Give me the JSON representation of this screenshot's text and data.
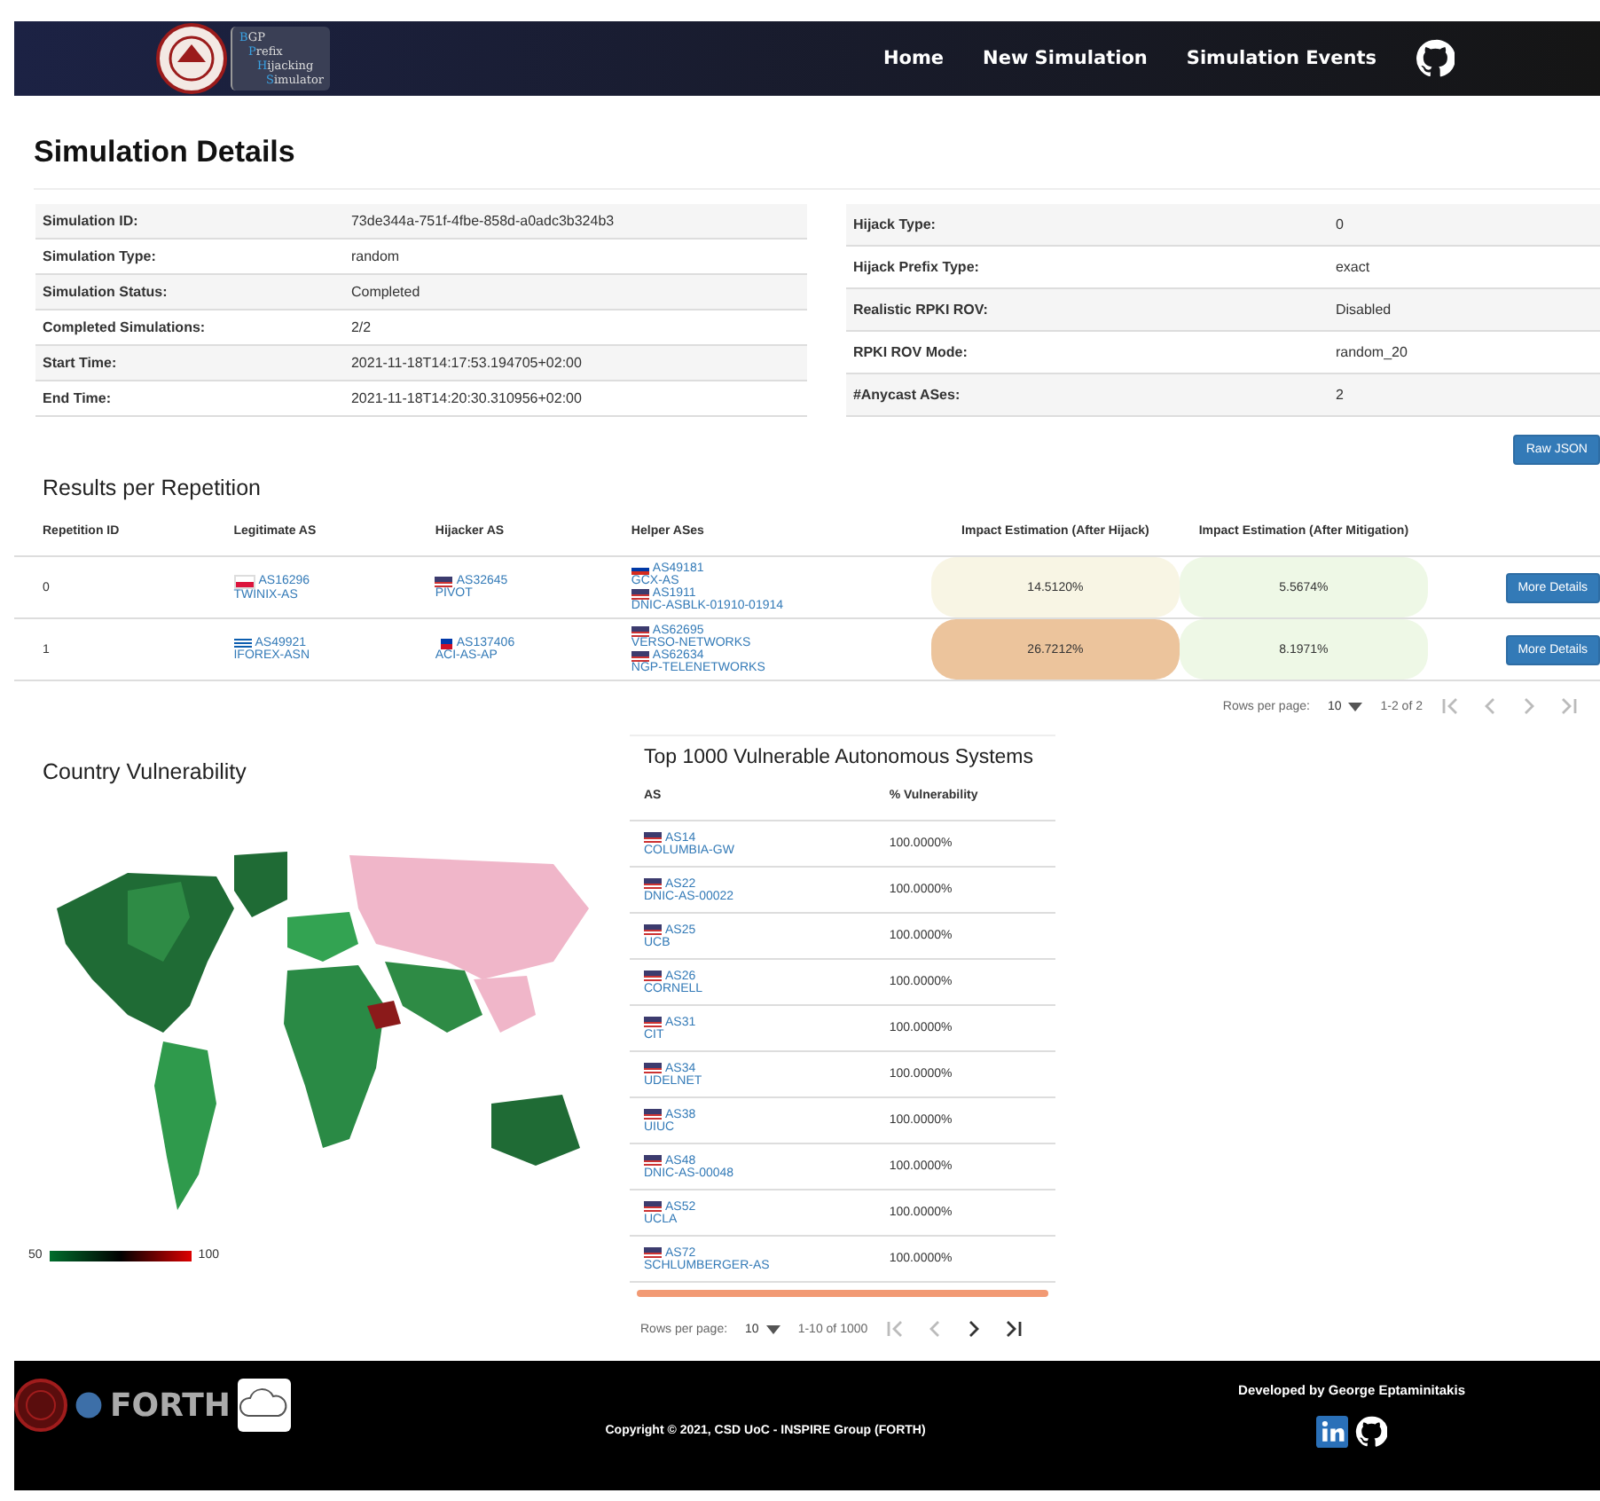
{
  "nav": {
    "logo_lines": [
      "BGP",
      "Prefix",
      "Hijacking",
      "Simulator"
    ],
    "links": [
      "Home",
      "New Simulation",
      "Simulation Events"
    ]
  },
  "title": "Simulation Details",
  "details_left": [
    {
      "label": "Simulation ID:",
      "value": "73de344a-751f-4fbe-858d-a0adc3b324b3"
    },
    {
      "label": "Simulation Type:",
      "value": "random"
    },
    {
      "label": "Simulation Status:",
      "value": "Completed"
    },
    {
      "label": "Completed Simulations:",
      "value": "2/2"
    },
    {
      "label": "Start Time:",
      "value": "2021-11-18T14:17:53.194705+02:00"
    },
    {
      "label": "End Time:",
      "value": "2021-11-18T14:20:30.310956+02:00"
    }
  ],
  "details_right": [
    {
      "label": "Hijack Type:",
      "value": "0"
    },
    {
      "label": "Hijack Prefix Type:",
      "value": "exact"
    },
    {
      "label": "Realistic RPKI ROV:",
      "value": "Disabled"
    },
    {
      "label": "RPKI ROV Mode:",
      "value": "random_20"
    },
    {
      "label": "#Anycast ASes:",
      "value": "2"
    }
  ],
  "raw_button": "Raw JSON",
  "results": {
    "title": "Results per Repetition",
    "columns": [
      "Repetition ID",
      "Legitimate AS",
      "Hijacker AS",
      "Helper ASes",
      "Impact Estimation (After Hijack)",
      "Impact Estimation (After Mitigation)"
    ],
    "rows": [
      {
        "id": "0",
        "legit": {
          "kind": "pl",
          "as": "AS16296",
          "name": "TWINIX-AS"
        },
        "hijacker": {
          "kind": "us",
          "as": "AS32645",
          "name": "PIVOT"
        },
        "helpers": [
          {
            "kind": "ru",
            "as": "AS49181",
            "name": "GCX-AS"
          },
          {
            "kind": "us",
            "as": "AS1911",
            "name": "DNIC-ASBLK-01910-01914"
          }
        ],
        "hijack": {
          "value": "14.5120%",
          "color": "#f8f5e4"
        },
        "mitigation": {
          "value": "5.5674%",
          "color": "#eef8e6"
        },
        "button": "More Details"
      },
      {
        "id": "1",
        "legit": {
          "kind": "gr",
          "as": "AS49921",
          "name": "IFOREX-ASN"
        },
        "hijacker": {
          "kind": "ph",
          "as": "AS137406",
          "name": "ACI-AS-AP"
        },
        "helpers": [
          {
            "kind": "us",
            "as": "AS62695",
            "name": "VERSO-NETWORKS"
          },
          {
            "kind": "us",
            "as": "AS62634",
            "name": "NGP-TELENETWORKS"
          }
        ],
        "hijack": {
          "value": "26.7212%",
          "color": "#ecc49c"
        },
        "mitigation": {
          "value": "8.1971%",
          "color": "#eef8e6"
        },
        "button": "More Details"
      }
    ],
    "pagination": {
      "label": "Rows per page:",
      "per_page": "10",
      "range": "1-2 of 2"
    }
  },
  "country": {
    "title": "Country Vulnerability",
    "legend_min": "50",
    "legend_max": "100"
  },
  "top": {
    "title": "Top 1000 Vulnerable Autonomous Systems",
    "columns": [
      "AS",
      "% Vulnerability"
    ],
    "rows": [
      {
        "kind": "us",
        "as": "AS14",
        "name": "COLUMBIA-GW",
        "value": "100.0000%"
      },
      {
        "kind": "us",
        "as": "AS22",
        "name": "DNIC-AS-00022",
        "value": "100.0000%"
      },
      {
        "kind": "us",
        "as": "AS25",
        "name": "UCB",
        "value": "100.0000%"
      },
      {
        "kind": "us",
        "as": "AS26",
        "name": "CORNELL",
        "value": "100.0000%"
      },
      {
        "kind": "us",
        "as": "AS31",
        "name": "CIT",
        "value": "100.0000%"
      },
      {
        "kind": "us",
        "as": "AS34",
        "name": "UDELNET",
        "value": "100.0000%"
      },
      {
        "kind": "us",
        "as": "AS38",
        "name": "UIUC",
        "value": "100.0000%"
      },
      {
        "kind": "us",
        "as": "AS48",
        "name": "DNIC-AS-00048",
        "value": "100.0000%"
      },
      {
        "kind": "us",
        "as": "AS52",
        "name": "UCLA",
        "value": "100.0000%"
      },
      {
        "kind": "us",
        "as": "AS72",
        "name": "SCHLUMBERGER-AS",
        "value": "100.0000%"
      }
    ],
    "pagination": {
      "label": "Rows per page:",
      "per_page": "10",
      "range": "1-10 of 1000"
    }
  },
  "footer": {
    "forth": "FORTH",
    "copyright": "Copyright © 2021, CSD UoC - INSPIRE Group (FORTH)",
    "developer": "Developed by George Eptaminitakis"
  }
}
